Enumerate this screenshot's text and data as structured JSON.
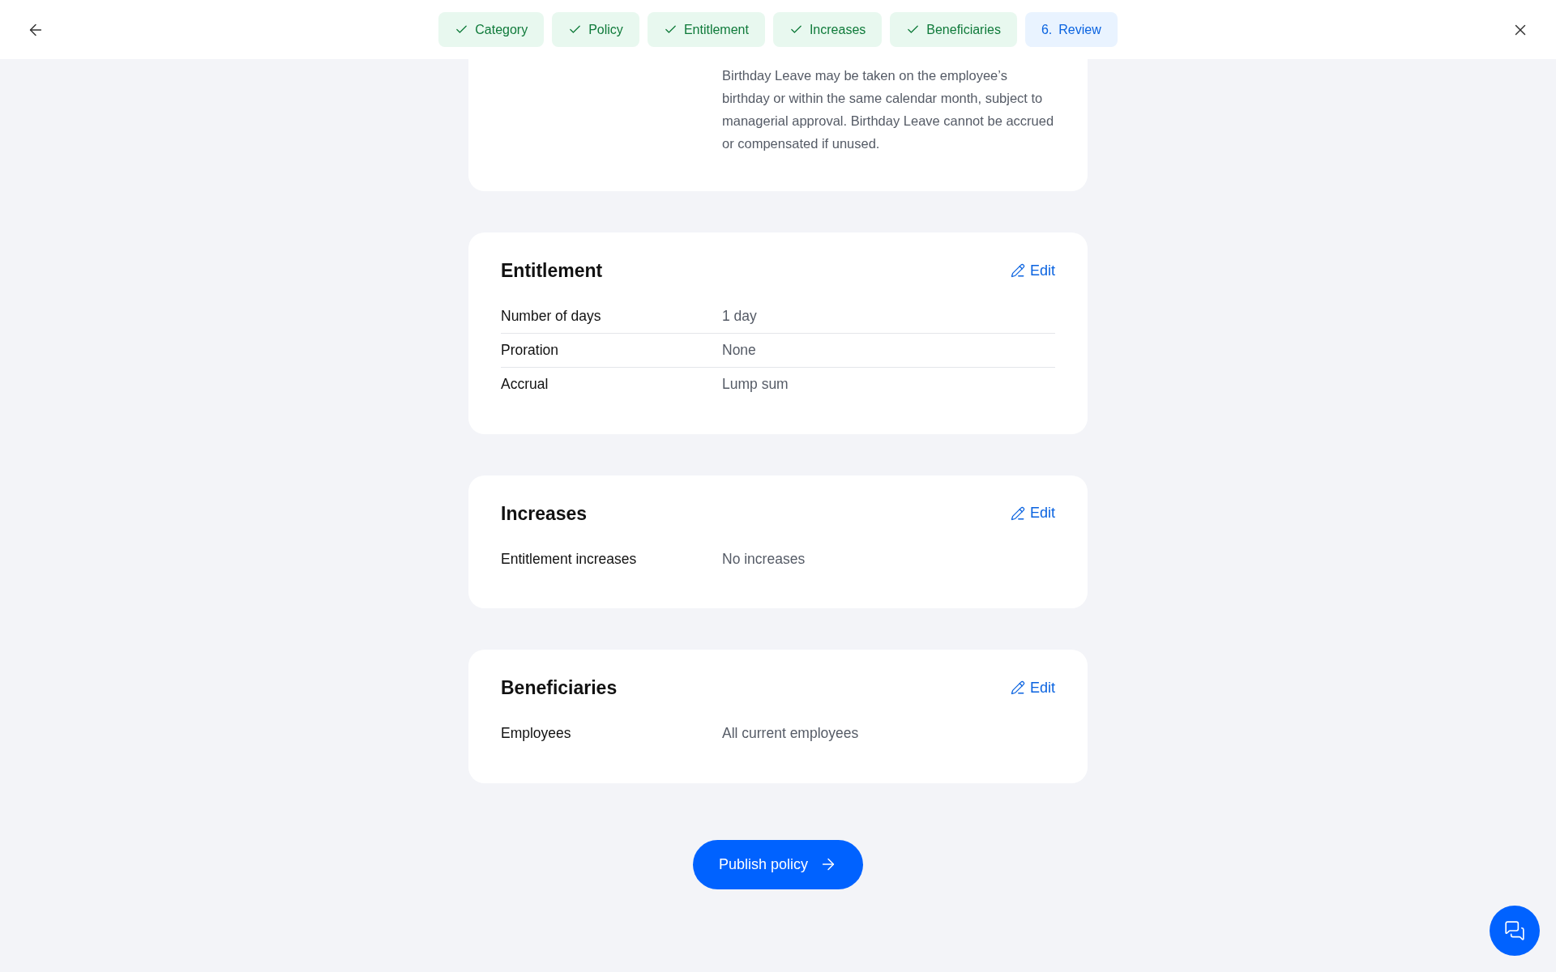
{
  "steps": [
    {
      "label": "Category",
      "done": true
    },
    {
      "label": "Policy",
      "done": true
    },
    {
      "label": "Entitlement",
      "done": true
    },
    {
      "label": "Increases",
      "done": true
    },
    {
      "label": "Beneficiaries",
      "done": true
    },
    {
      "label": "Review",
      "number": "6.",
      "done": false
    }
  ],
  "intro": {
    "text": "Birthday Leave may be taken on the employee’s birthday or within the same calendar month, subject to managerial approval. Birthday Leave cannot be accrued or compensated if unused."
  },
  "sections": [
    {
      "title": "Entitlement",
      "edit": "Edit",
      "rows": [
        {
          "label": "Number of days",
          "value": "1 day"
        },
        {
          "label": "Proration",
          "value": "None"
        },
        {
          "label": "Accrual",
          "value": "Lump sum"
        }
      ]
    },
    {
      "title": "Increases",
      "edit": "Edit",
      "rows": [
        {
          "label": "Entitlement increases",
          "value": "No increases"
        }
      ]
    },
    {
      "title": "Beneficiaries",
      "edit": "Edit",
      "rows": [
        {
          "label": "Employees",
          "value": "All current employees"
        }
      ]
    }
  ],
  "publish": "Publish policy"
}
